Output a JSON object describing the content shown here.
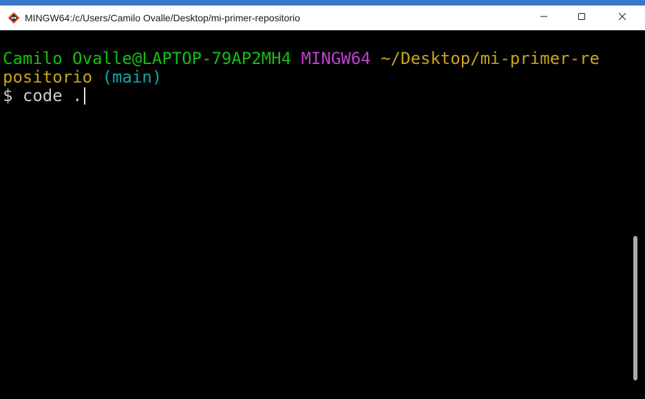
{
  "window": {
    "title": "MINGW64:/c/Users/Camilo Ovalle/Desktop/mi-primer-repositorio",
    "app_icon": "git-bash-icon",
    "controls": {
      "minimize_icon": "minimize-icon",
      "maximize_icon": "maximize-icon",
      "close_icon": "close-icon"
    }
  },
  "terminal": {
    "prompt": {
      "user_host": "Camilo Ovalle@LAPTOP-79AP2MH4",
      "system": "MINGW64",
      "path_line1": "~/Desktop/mi-primer-re",
      "path_line2": "positorio",
      "branch": "(main)"
    },
    "command_line": {
      "symbol": "$",
      "command": "code ."
    }
  },
  "colors": {
    "user_host": "#13c013",
    "system": "#c23fd1",
    "path": "#c9a31d",
    "branch": "#11a8a8",
    "command": "#cccccc",
    "background": "#000000"
  }
}
